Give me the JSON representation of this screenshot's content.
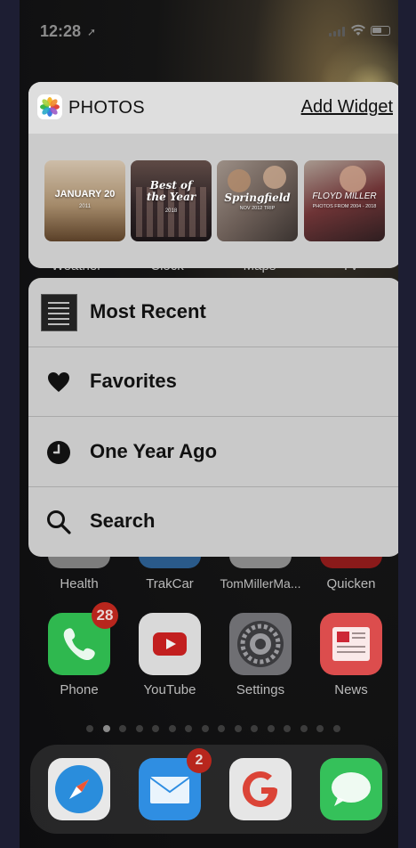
{
  "status_bar": {
    "time": "12:28",
    "location_glyph": "➚"
  },
  "widget": {
    "app_name": "PHOTOS",
    "add_label": "Add Widget",
    "memories": [
      {
        "title": "JANUARY 20",
        "subtitle": "2011"
      },
      {
        "title": "Best of the Year",
        "subtitle": "2018"
      },
      {
        "title": "Springfield",
        "subtitle": "NOV 2012 TRIP"
      },
      {
        "title": "FLOYD MILLER",
        "subtitle": "PHOTOS FROM 2004 - 2018"
      }
    ]
  },
  "menu": {
    "items": [
      {
        "label": "Most Recent",
        "icon": "recent-thumbnail"
      },
      {
        "label": "Favorites",
        "icon": "heart-icon"
      },
      {
        "label": "One Year Ago",
        "icon": "clock-icon"
      },
      {
        "label": "Search",
        "icon": "search-icon"
      }
    ]
  },
  "homescreen": {
    "row1_labels": [
      "Weather",
      "Clock",
      "Maps",
      "TV"
    ],
    "row2_labels": [
      "Health",
      "TrakCar",
      "TomMillerMa...",
      "Quicken"
    ],
    "row3": [
      {
        "label": "Phone",
        "badge": "28",
        "color": "#2fb84f"
      },
      {
        "label": "YouTube",
        "badge": "",
        "color": "#e6e6e6"
      },
      {
        "label": "Settings",
        "badge": "",
        "color": "#8e8e93"
      },
      {
        "label": "News",
        "badge": "",
        "color": "#e24b4b"
      }
    ],
    "page_count": 16,
    "active_page": 2,
    "dock": [
      {
        "name": "safari",
        "badge": ""
      },
      {
        "name": "mail",
        "badge": "2"
      },
      {
        "name": "google",
        "badge": ""
      },
      {
        "name": "messages",
        "badge": ""
      }
    ]
  },
  "colors": {
    "menu_bg": "#c9c9c9",
    "widget_head": "#dedede",
    "badge_red": "#b8261d"
  }
}
